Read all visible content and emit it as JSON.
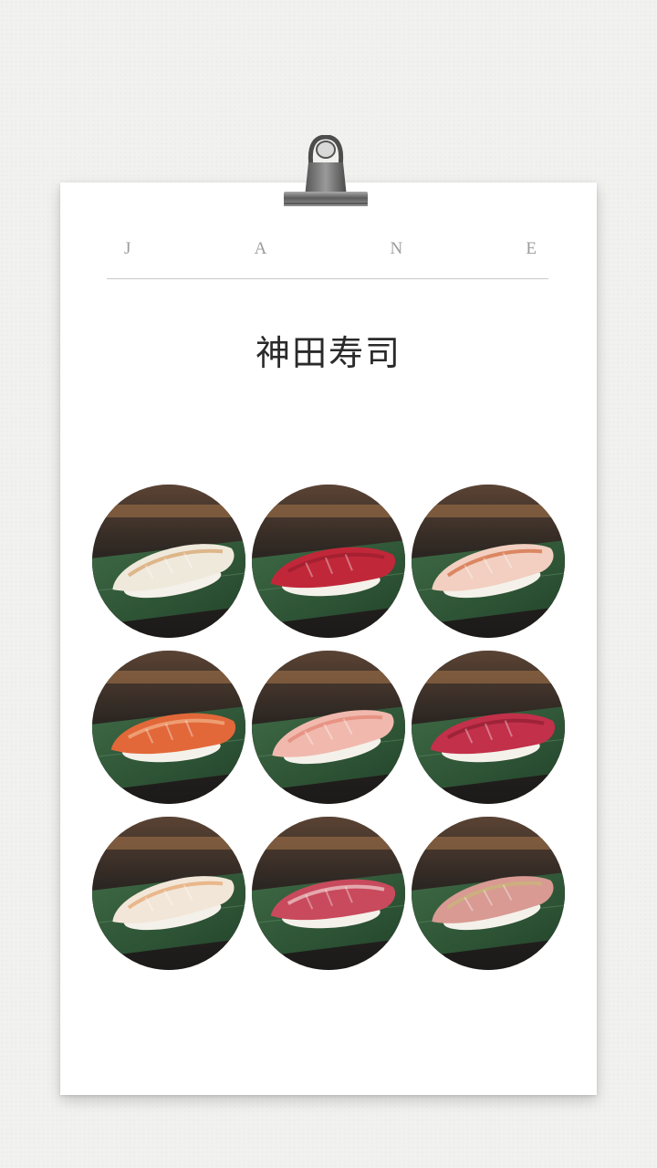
{
  "header": {
    "letters": [
      "J",
      "A",
      "N",
      "E"
    ],
    "title": "神田寿司"
  },
  "clip_icon": "binder-clip-icon",
  "gallery": [
    {
      "name": "sushi-photo-white-fish",
      "fish": "#efe9dc",
      "accent": "#d6a067"
    },
    {
      "name": "sushi-photo-tuna-akami",
      "fish": "#c0283a",
      "accent": "#9a1c2c"
    },
    {
      "name": "sushi-photo-seared-kinmedai",
      "fish": "#f2cfc0",
      "accent": "#d2663a"
    },
    {
      "name": "sushi-photo-crab",
      "fish": "#e2683a",
      "accent": "#f4b48a"
    },
    {
      "name": "sushi-photo-sweet-shrimp",
      "fish": "#f1b9ae",
      "accent": "#e28372"
    },
    {
      "name": "sushi-photo-tuna-chutoro",
      "fish": "#c2304a",
      "accent": "#8f1e30"
    },
    {
      "name": "sushi-photo-seared-white-fish",
      "fish": "#f2e6d8",
      "accent": "#e6a36a"
    },
    {
      "name": "sushi-photo-toro",
      "fish": "#c84a5c",
      "accent": "#f0d0d0"
    },
    {
      "name": "sushi-photo-aji",
      "fish": "#d89a92",
      "accent": "#c8b878"
    }
  ]
}
